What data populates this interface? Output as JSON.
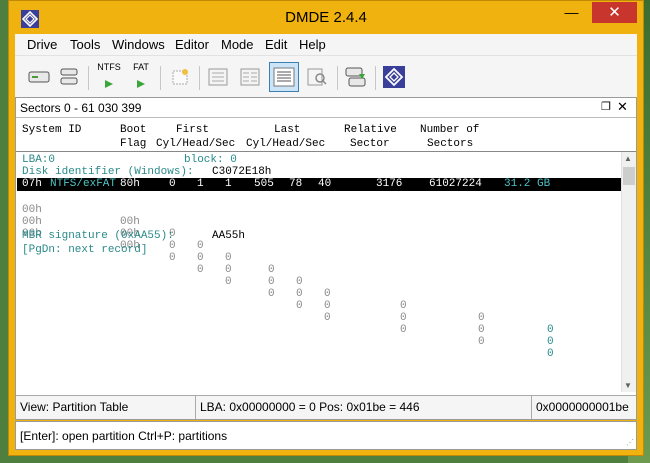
{
  "window": {
    "title": "DMDE 2.4.4",
    "min_label": "—",
    "max_label": "☐",
    "close_label": "✕"
  },
  "menu": [
    "Drive",
    "Tools",
    "Windows",
    "Editor",
    "Mode",
    "Edit",
    "Help"
  ],
  "toolbar": {
    "ntfs_label": "NTFS",
    "fat_label": "FAT",
    "buttons": [
      "drive-icon",
      "partitions-icon",
      "ntfs-icon",
      "fat-icon",
      "scan-icon",
      "file-panel-icon",
      "list-panel-icon",
      "partition-table-view-icon",
      "find-icon",
      "copy-sectors-icon",
      "dmde-logo-icon"
    ]
  },
  "panel": {
    "title": "Sectors 0 - 61 030 399",
    "restore_label": "❐",
    "close_label": "✕",
    "headers_row1": [
      "System ID",
      "Boot",
      "First",
      "Last",
      "Relative",
      "Number of"
    ],
    "headers_row2": [
      "Flag",
      "Cyl/Head/Sec",
      "Cyl/Head/Sec",
      "Sector",
      "Sectors"
    ],
    "lba_label": "LBA:0",
    "block_label": "block: 0",
    "disk_id_label": "Disk identifier (Windows):",
    "disk_id_value": "C3072E18h",
    "partitions": [
      {
        "id": "07h",
        "name": "NTFS/exFAT",
        "flag": "80h",
        "fc": "0",
        "fh": "1",
        "fs": "1",
        "lc": "505",
        "lh": "78",
        "ls": "40",
        "rel": "3176",
        "num": "61027224",
        "size": "31.2 GB"
      },
      {
        "id": "00h",
        "name": "",
        "flag": "00h",
        "fc": "0",
        "fh": "0",
        "fs": "0",
        "lc": "0",
        "lh": "0",
        "ls": "0",
        "rel": "0",
        "num": "0",
        "size": "0"
      },
      {
        "id": "00h",
        "name": "",
        "flag": "00h",
        "fc": "0",
        "fh": "0",
        "fs": "0",
        "lc": "0",
        "lh": "0",
        "ls": "0",
        "rel": "0",
        "num": "0",
        "size": "0"
      },
      {
        "id": "00h",
        "name": "",
        "flag": "00h",
        "fc": "0",
        "fh": "0",
        "fs": "0",
        "lc": "0",
        "lh": "0",
        "ls": "0",
        "rel": "0",
        "num": "0",
        "size": "0"
      }
    ],
    "mbr_label": "MBR signature (0xAA55):",
    "mbr_value": "AA55h",
    "pgdn_label": "[PgDn: next record]"
  },
  "status": {
    "view": "View: Partition Table",
    "position": "LBA: 0x00000000 = 0  Pos: 0x01be = 446",
    "offset": "0x0000000001be"
  },
  "hint": "[Enter]: open partition  Ctrl+P: partitions",
  "colors": {
    "title_bg": "#f0b20f",
    "close_bg": "#c7352c",
    "teal_text": "#2a8a8a",
    "selection_bg": "#000000",
    "selection_text": "#ffffff"
  }
}
